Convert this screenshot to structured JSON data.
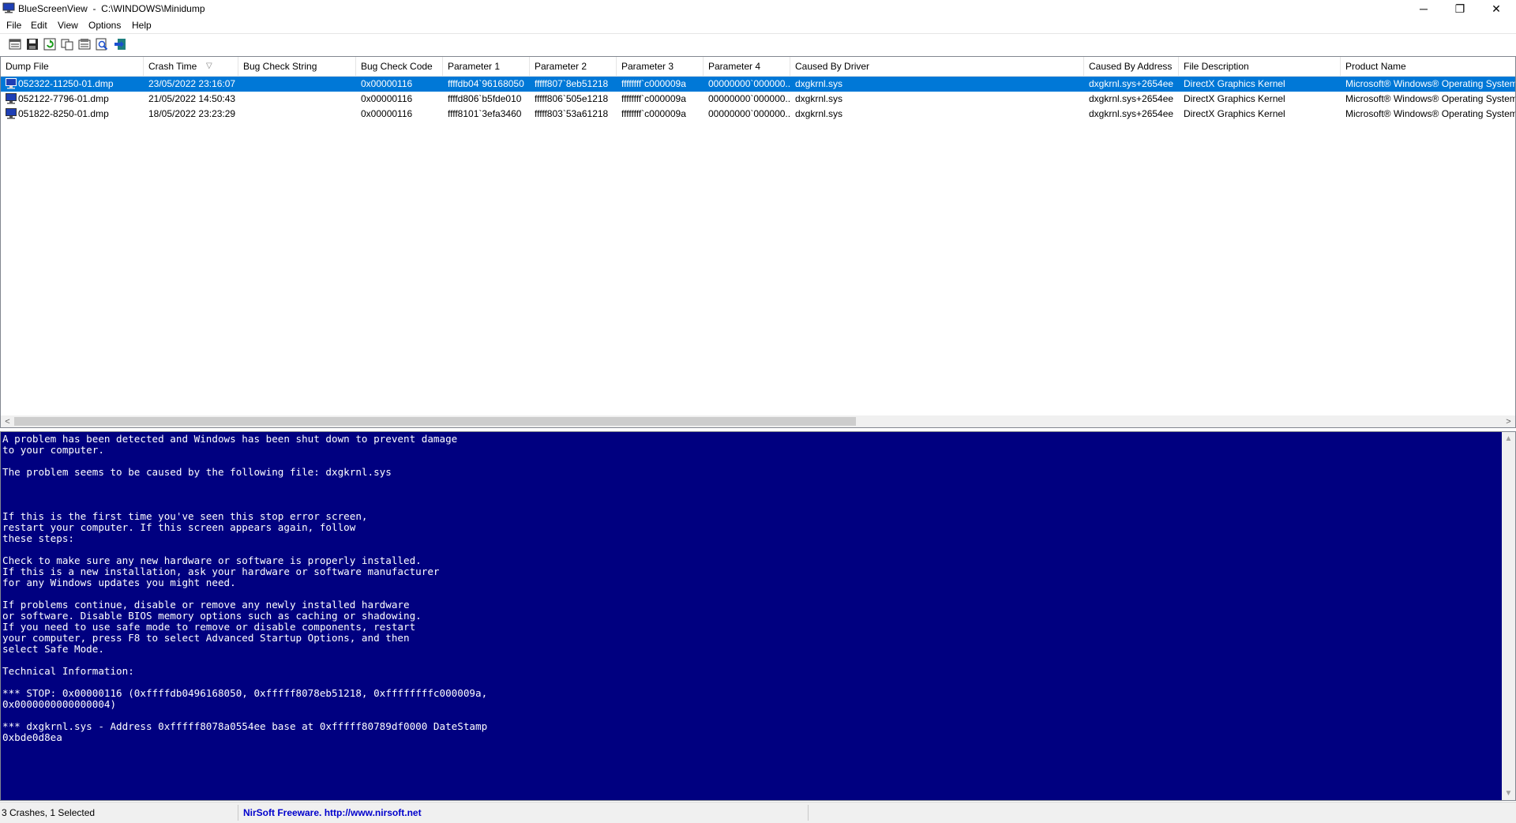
{
  "window": {
    "title": "BlueScreenView  -  C:\\WINDOWS\\Minidump",
    "minimize_glyph": "─",
    "restore_glyph": "❐",
    "close_glyph": "✕"
  },
  "menu": {
    "items": [
      "File",
      "Edit",
      "View",
      "Options",
      "Help"
    ]
  },
  "toolbar": {
    "buttons": [
      {
        "icon": "properties-icon"
      },
      {
        "icon": "save-icon"
      },
      {
        "icon": "refresh-icon"
      },
      {
        "icon": "copy-icon"
      },
      {
        "icon": "html-report-icon"
      },
      {
        "icon": "find-icon"
      },
      {
        "icon": "exit-icon"
      }
    ]
  },
  "table": {
    "columns": [
      "Dump File",
      "Crash Time",
      "Bug Check String",
      "Bug Check Code",
      "Parameter 1",
      "Parameter 2",
      "Parameter 3",
      "Parameter 4",
      "Caused By Driver",
      "Caused By Address",
      "File Description",
      "Product Name"
    ],
    "sort_indicator": "▽",
    "rows": [
      [
        "052322-11250-01.dmp",
        "23/05/2022 23:16:07",
        "",
        "0x00000116",
        "ffffdb04`96168050",
        "fffff807`8eb51218",
        "ffffffff`c000009a",
        "00000000`000000...",
        "dxgkrnl.sys",
        "dxgkrnl.sys+2654ee",
        "DirectX Graphics Kernel",
        "Microsoft® Windows® Operating System"
      ],
      [
        "052122-7796-01.dmp",
        "21/05/2022 14:50:43",
        "",
        "0x00000116",
        "ffffd806`b5fde010",
        "fffff806`505e1218",
        "ffffffff`c000009a",
        "00000000`000000...",
        "dxgkrnl.sys",
        "dxgkrnl.sys+2654ee",
        "DirectX Graphics Kernel",
        "Microsoft® Windows® Operating System"
      ],
      [
        "051822-8250-01.dmp",
        "18/05/2022 23:23:29",
        "",
        "0x00000116",
        "ffff8101`3efa3460",
        "fffff803`53a61218",
        "ffffffff`c000009a",
        "00000000`000000...",
        "dxgkrnl.sys",
        "dxgkrnl.sys+2654ee",
        "DirectX Graphics Kernel",
        "Microsoft® Windows® Operating System"
      ]
    ],
    "selected_row": 0
  },
  "scrollbar": {
    "left_arrow": "<",
    "right_arrow": ">",
    "up_arrow": "▲",
    "down_arrow": "▼"
  },
  "bsod": {
    "text": "A problem has been detected and Windows has been shut down to prevent damage\nto your computer.\n\nThe problem seems to be caused by the following file: dxgkrnl.sys\n\n\n\nIf this is the first time you've seen this stop error screen,\nrestart your computer. If this screen appears again, follow\nthese steps:\n\nCheck to make sure any new hardware or software is properly installed.\nIf this is a new installation, ask your hardware or software manufacturer\nfor any Windows updates you might need.\n\nIf problems continue, disable or remove any newly installed hardware\nor software. Disable BIOS memory options such as caching or shadowing.\nIf you need to use safe mode to remove or disable components, restart\nyour computer, press F8 to select Advanced Startup Options, and then\nselect Safe Mode.\n\nTechnical Information:\n\n*** STOP: 0x00000116 (0xffffdb0496168050, 0xfffff8078eb51218, 0xffffffffc000009a,\n0x0000000000000004)\n\n*** dxgkrnl.sys - Address 0xfffff8078a0554ee base at 0xfffff80789df0000 DateStamp\n0xbde0d8ea"
  },
  "status": {
    "count": "3 Crashes, 1 Selected",
    "freeware": "NirSoft Freeware.  http://www.nirsoft.net"
  },
  "colors": {
    "selection": "#0078d7",
    "bsod_background": "#000080",
    "link": "#0000cc"
  }
}
